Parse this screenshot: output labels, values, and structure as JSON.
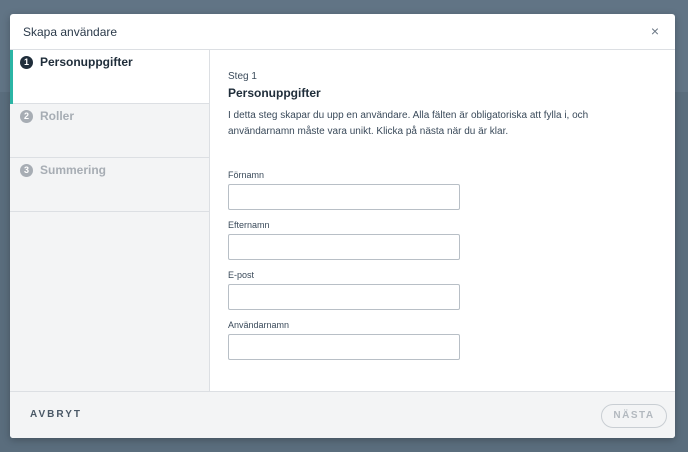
{
  "modal": {
    "title": "Skapa användare",
    "close_symbol": "×"
  },
  "sidebar": {
    "steps": [
      {
        "number": "1",
        "label": "Personuppgifter",
        "state": "active"
      },
      {
        "number": "2",
        "label": "Roller",
        "state": "inactive"
      },
      {
        "number": "3",
        "label": "Summering",
        "state": "inactive"
      }
    ]
  },
  "main": {
    "step_counter": "Steg 1",
    "title": "Personuppgifter",
    "description": "I detta steg skapar du upp en användare. Alla fälten är obligatoriska att fylla i, och användarnamn måste vara unikt. Klicka på nästa när du är klar.",
    "fields": [
      {
        "label": "Förnamn",
        "value": ""
      },
      {
        "label": "Efternamn",
        "value": ""
      },
      {
        "label": "E-post",
        "value": ""
      },
      {
        "label": "Användarnamn",
        "value": ""
      }
    ]
  },
  "footer": {
    "cancel_label": "AVBRYT",
    "next_label": "NÄSTA"
  },
  "colors": {
    "accent": "#2bb5a5",
    "backdrop": "#5f7282"
  }
}
